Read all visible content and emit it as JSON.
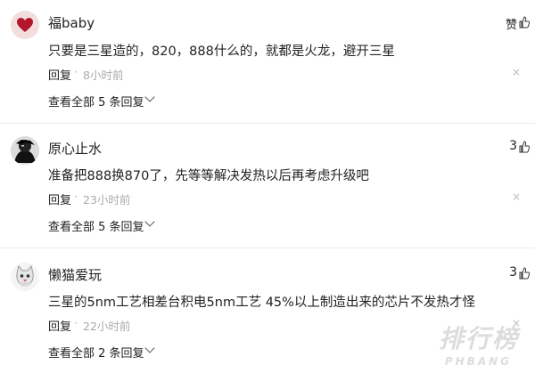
{
  "comments": [
    {
      "username": "福baby",
      "like_label": "赞",
      "text": "只要是三星造的，820，888什么的，就都是火龙，避开三星",
      "reply_label": "回复",
      "dot": "·",
      "time": "8小时前",
      "close": "×",
      "view_all": "查看全部 5 条回复",
      "avatar_icon": "red-heart-icon"
    },
    {
      "username": "原心止水",
      "like_count": "3",
      "text": "准备把888换870了，先等等解决发热以后再考虑升级吧",
      "reply_label": "回复",
      "dot": "·",
      "time": "23小时前",
      "close": "×",
      "view_all": "查看全部 5 条回复",
      "avatar_icon": "black-white-portrait-icon"
    },
    {
      "username": "懒猫爱玩",
      "like_count": "3",
      "text": "三星的5nm工艺相差台积电5nm工艺 45%以上制造出来的芯片不发热才怪",
      "reply_label": "回复",
      "dot": "·",
      "time": "22小时前",
      "close": "×",
      "view_all": "查看全部 2 条回复",
      "avatar_icon": "cat-icon"
    }
  ],
  "watermark": {
    "main": "排行榜",
    "sub": "PHBANG"
  },
  "colors": {
    "text": "#222222",
    "meta": "#aaaaaa",
    "divider": "#eaeaea",
    "heart": "#c0392b"
  }
}
